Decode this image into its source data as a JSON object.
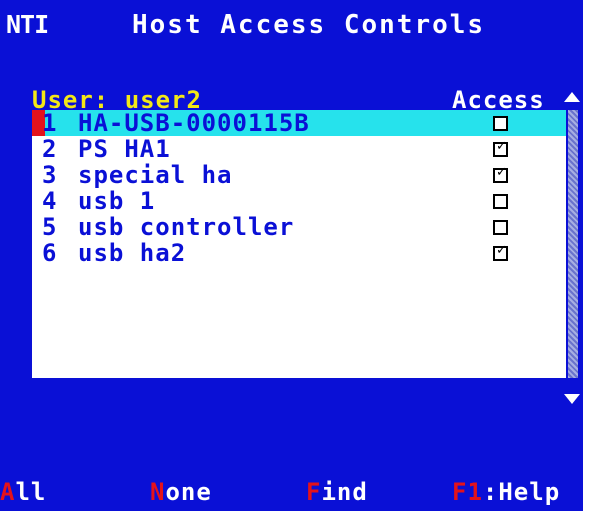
{
  "header": {
    "logo": "NTI",
    "title": "Host Access Controls"
  },
  "user": {
    "label": "User:",
    "name": "user2"
  },
  "access_header": "Access",
  "hosts": [
    {
      "num": "1",
      "name": "HA-USB-0000115B",
      "access": false,
      "selected": true
    },
    {
      "num": "2",
      "name": "PS HA1",
      "access": true,
      "selected": false
    },
    {
      "num": "3",
      "name": "special ha",
      "access": true,
      "selected": false
    },
    {
      "num": "4",
      "name": "usb 1",
      "access": false,
      "selected": false
    },
    {
      "num": "5",
      "name": "usb controller",
      "access": false,
      "selected": false
    },
    {
      "num": "6",
      "name": "usb ha2",
      "access": true,
      "selected": false
    }
  ],
  "footer": {
    "all": {
      "hot": "A",
      "rest": "ll"
    },
    "none": {
      "hot": "N",
      "rest": "one"
    },
    "find": {
      "hot": "F",
      "rest": "ind"
    },
    "help": {
      "hot": "F1",
      "rest": ":Help"
    }
  },
  "colors": {
    "background": "#0a10d6",
    "selection": "#26e2ec",
    "cursor": "#e4121b",
    "user_text": "#f3e817",
    "hotkey": "#e4121b"
  },
  "icons": {
    "checked": "✓",
    "scroll_up": "scroll-up-arrow",
    "scroll_down": "scroll-down-arrow"
  }
}
